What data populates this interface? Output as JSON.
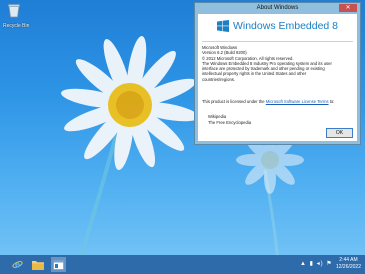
{
  "desktop": {
    "recycle_bin_label": "Recycle Bin"
  },
  "dialog": {
    "title": "About Windows",
    "close_label": "✕",
    "product_name": "Windows Embedded 8",
    "info_lines": [
      "Microsoft Windows",
      "Version 6.2 (Build 9200)",
      "© 2012 Microsoft Corporation. All rights reserved.",
      "The Windows Embedded 8 Industry Pro operating system and its user",
      "interface are protected by trademark and other pending or existing",
      "intellectual property rights in the United States and other",
      "countries/regions."
    ],
    "license_text_before": "This product is licensed under the ",
    "license_link": "Microsoft Software License Terms",
    "license_text_after": " to:",
    "user_name": "Wikipedia",
    "organization": "The Free Encyclopedia",
    "ok_label": "OK"
  },
  "taskbar": {
    "items": [
      "internet-explorer",
      "file-explorer",
      "about-windows"
    ],
    "tray_icons": "▲ ▮ ◂) ⚑",
    "time": "2:44 AM",
    "date": "12/26/2022"
  }
}
